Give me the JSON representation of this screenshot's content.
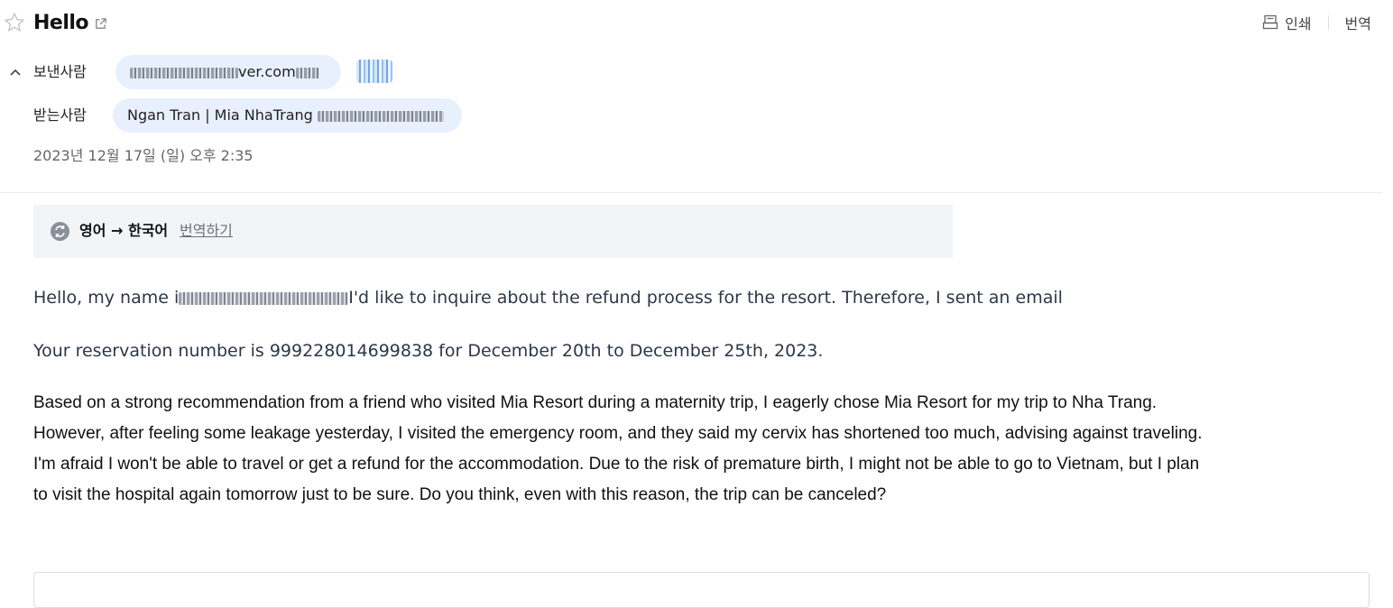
{
  "mail": {
    "subject": "Hello",
    "toolbar": {
      "print_label": "인쇄",
      "translate_label": "번역"
    },
    "sender": {
      "label": "보낸사람",
      "address_visible": "ver.com"
    },
    "recipient": {
      "label": "받는사람",
      "name": "Ngan Tran | Mia NhaTrang"
    },
    "date": "2023년 12월 17일 (일) 오후 2:35"
  },
  "translate_bar": {
    "languages": "영어 → 한국어",
    "action_label": "번역하기"
  },
  "body": {
    "p1_start": "Hello, my name i",
    "p1_end": "I'd like to inquire about the refund process for the resort. Therefore, I sent an email",
    "p2": "Your reservation number is 999228014699838 for December 20th to December 25th, 2023.",
    "p3_lines": [
      "Based on a strong recommendation from a friend who visited Mia Resort during a maternity trip, I eagerly chose Mia Resort for my trip to Nha Trang.",
      "However, after feeling some leakage yesterday, I visited the emergency room, and they said my cervix has shortened too much, advising against traveling.",
      "I'm afraid I won't be able to travel or get a refund for the accommodation. Due to the risk of premature birth, I might not be able to go to Vietnam, but I plan",
      "to visit the hospital again tomorrow just to be sure. Do you think, even with this reason, the trip can be canceled?"
    ]
  },
  "colors": {
    "pill_bg": "#e8f0fd",
    "translate_bar_bg": "#f3f4f6",
    "link": "#6b7280"
  },
  "icons": [
    "star-icon",
    "external-link-icon",
    "print-icon",
    "chevron-up-icon",
    "translate-icon"
  ]
}
